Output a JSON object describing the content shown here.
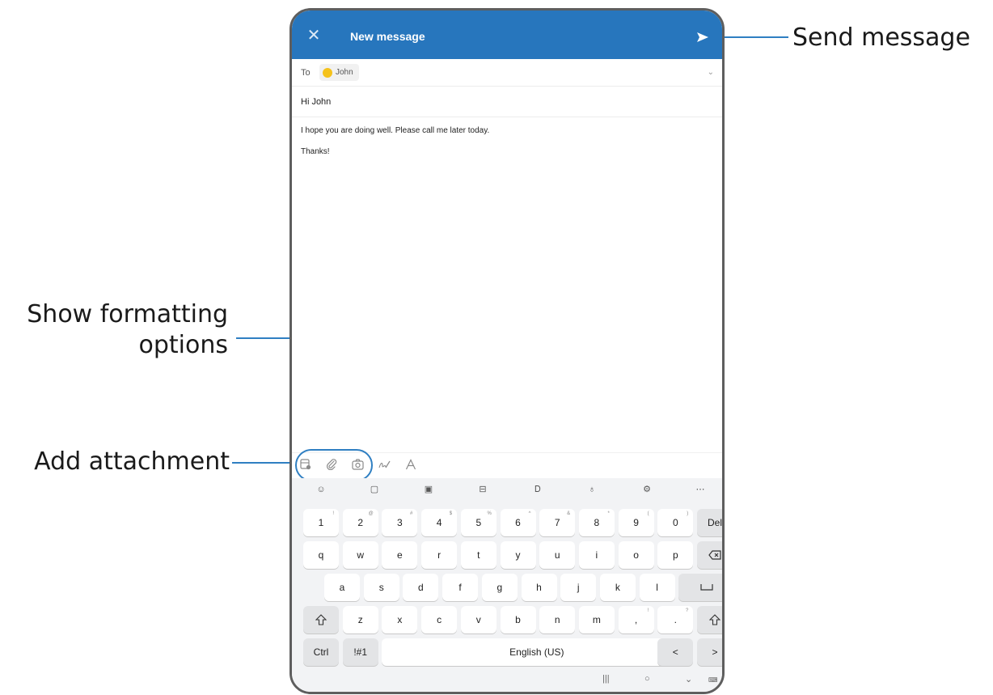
{
  "callouts": {
    "send": "Send message",
    "format": "Show formatting options",
    "attach": "Add attachment"
  },
  "header": {
    "close_icon": "close-icon",
    "title": "New message",
    "send_icon": "send-icon"
  },
  "compose": {
    "to_label": "To",
    "recipient": "John",
    "subject": "Hi John",
    "body_line1": "I hope you are doing well. Please call me later today.",
    "body_line2": "Thanks!"
  },
  "format_bar": {
    "icons": [
      "insert-file-icon",
      "paperclip-icon",
      "camera-icon",
      "handwriting-icon",
      "text-format-icon"
    ]
  },
  "keyboard": {
    "toolbar_icons": [
      "emoji-icon",
      "clipboard-icon",
      "keyboard-mode-icon",
      "sticker-icon",
      "handwriting-icon",
      "microphone-icon",
      "settings-icon",
      "more-icon"
    ],
    "row1": [
      "1",
      "2",
      "3",
      "4",
      "5",
      "6",
      "7",
      "8",
      "9",
      "0",
      "Del"
    ],
    "row1_sup": [
      "!",
      "@",
      "#",
      "$",
      "%",
      "^",
      "&",
      "*",
      "(",
      ")",
      ""
    ],
    "row2": [
      "q",
      "w",
      "e",
      "r",
      "t",
      "y",
      "u",
      "i",
      "o",
      "p"
    ],
    "row3": [
      "a",
      "s",
      "d",
      "f",
      "g",
      "h",
      "j",
      "k",
      "l"
    ],
    "row4": [
      "z",
      "x",
      "c",
      "v",
      "b",
      "n",
      "m",
      ",",
      "."
    ],
    "row4_sup": [
      "",
      "",
      "",
      "",
      "",
      "",
      "",
      "!",
      "?"
    ],
    "ctrl": "Ctrl",
    "symbols": "!#1",
    "space": "English (US)",
    "left_arrow": "<",
    "right_arrow": ">"
  },
  "colors": {
    "header": "#2776bd",
    "callout_line": "#2f7fc2",
    "avatar": "#f5c21b"
  }
}
